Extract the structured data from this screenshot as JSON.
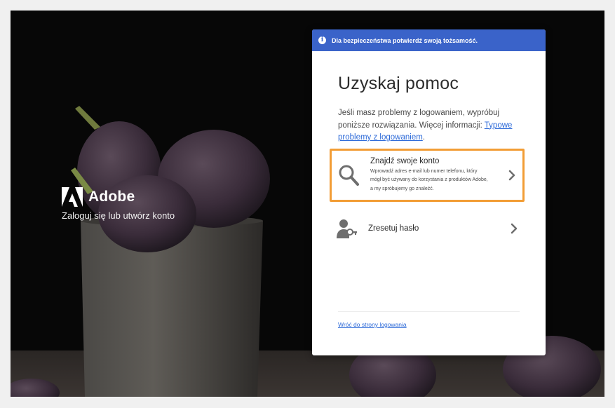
{
  "brand": {
    "name": "Adobe",
    "tagline": "Zaloguj się lub utwórz konto"
  },
  "banner": {
    "icon": "info-icon",
    "text": "Dla bezpieczeństwa potwierdź swoją tożsamość."
  },
  "card": {
    "title": "Uzyskaj pomoc",
    "description": "Jeśli masz problemy z logowaniem, wypróbuj poniższe rozwiązania. Więcej informacji: ",
    "description_link": "Typowe problemy z logowaniem",
    "description_end": "."
  },
  "options": [
    {
      "icon": "search-icon",
      "title": "Znajdź swoje konto",
      "desc_lines": [
        "Wprowadź adres e-mail lub numer telefonu, który",
        "mógł być używany do korzystania z produktów Adobe,",
        "a my spróbujemy go znaleźć."
      ],
      "highlighted": true
    },
    {
      "icon": "user-key-icon",
      "title": "Zresetuj hasło",
      "highlighted": false
    }
  ],
  "footer": {
    "back_link": "Wróć do strony logowania"
  },
  "colors": {
    "banner": "#3a63c9",
    "link": "#2d6ad8",
    "highlight_border": "#f29d35"
  }
}
